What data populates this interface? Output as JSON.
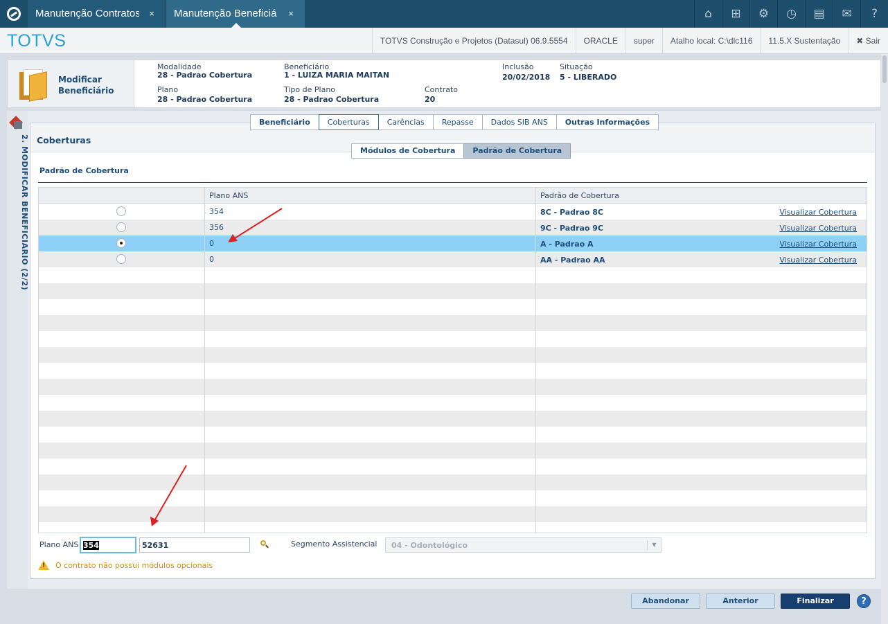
{
  "window_tabs": [
    {
      "label": "Manutenção Contratos",
      "close": "×"
    },
    {
      "label": "Manutenção Beneficiá",
      "close": "×"
    }
  ],
  "top_icons": [
    "home-icon",
    "sitemap-icon",
    "gear-icon",
    "clock-icon",
    "document-icon",
    "mail-icon",
    "help-icon"
  ],
  "brand": "TOTVS",
  "info_bar": {
    "product": "TOTVS Construção e Projetos (Datasul) 06.9.5554",
    "db": "ORACLE",
    "user": "super",
    "shortcut": "Atalho local: C:\\dlc116",
    "version": "11.5.X Sustentação",
    "logout": "✖ Sair"
  },
  "page_header": {
    "title": "Modificar Beneficiário",
    "fields": {
      "modalidade_label": "Modalidade",
      "modalidade_value": "28 - Padrao Cobertura",
      "beneficiario_label": "Beneficiário",
      "beneficiario_value": "1 - LUIZA MARIA MAITAN",
      "inclusao_label": "Inclusão",
      "inclusao_value": "20/02/2018",
      "situacao_label": "Situação",
      "situacao_value": "5 - LIBERADO",
      "plano_label": "Plano",
      "plano_value": "28 - Padrao Cobertura",
      "tipo_plano_label": "Tipo de Plano",
      "tipo_plano_value": "28 - Padrao Cobertura",
      "contrato_label": "Contrato",
      "contrato_value": "20"
    }
  },
  "side_rail": {
    "label": "2. MODIFICAR BENEFICIÁRIO (2/2)"
  },
  "nav_tabs": [
    "Beneficiário",
    "Coberturas",
    "Carências",
    "Repasse",
    "Dados SIB ANS",
    "Outras Informações"
  ],
  "active_nav_tab": "Coberturas",
  "section": {
    "title": "Coberturas",
    "sub_tabs": [
      "Módulos de Cobertura",
      "Padrão de Cobertura"
    ],
    "active_sub_tab": "Padrão de Cobertura",
    "subtitle": "Padrão de Cobertura"
  },
  "grid": {
    "columns": [
      "",
      "Plano ANS",
      "Padrão de Cobertura"
    ],
    "rows": [
      {
        "selected": false,
        "plano_ans": "354",
        "padrao": "8C - Padrao 8C",
        "link": "Visualizar Cobertura"
      },
      {
        "selected": false,
        "plano_ans": "356",
        "padrao": "9C - Padrao 9C",
        "link": "Visualizar Cobertura"
      },
      {
        "selected": true,
        "plano_ans": "0",
        "padrao": "A - Padrao A",
        "link": "Visualizar Cobertura"
      },
      {
        "selected": false,
        "plano_ans": "0",
        "padrao": "AA - Padrao AA",
        "link": "Visualizar Cobertura"
      }
    ]
  },
  "form": {
    "plano_ans_label": "Plano ANS",
    "plano_ans_value": "354",
    "plano_ans_code": "52631",
    "segmento_label": "Segmento Assistencial",
    "segmento_value": "04 - Odontológico"
  },
  "warning": "O contrato não possui módulos opcionais",
  "footer": {
    "abandon": "Abandonar",
    "previous": "Anterior",
    "finish": "Finalizar",
    "help": "?"
  },
  "colors": {
    "topbar": "#1d4e6b",
    "brand": "#29a1d3",
    "selected_row": "#8fd0f6",
    "primary_button": "#163e6e",
    "arrow": "#e02020"
  }
}
